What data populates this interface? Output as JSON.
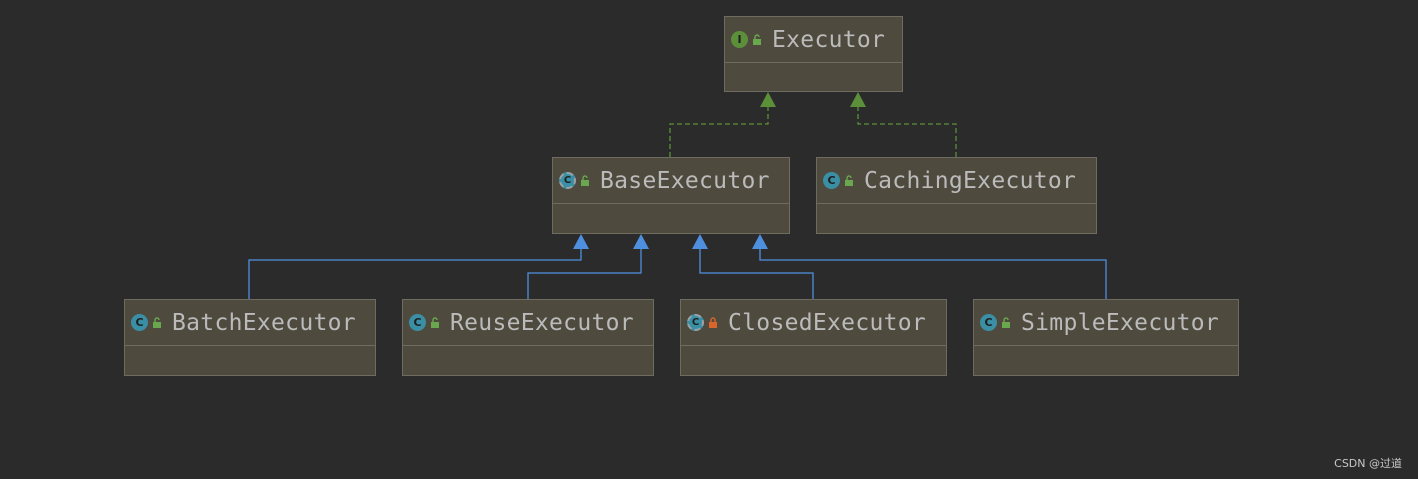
{
  "colors": {
    "background": "#2b2b2b",
    "node_fill": "#4e4a3e",
    "node_border": "#6e6b61",
    "implements_edge": "#5c8f3a",
    "extends_edge": "#4f8fe0",
    "text": "#bbbbbb"
  },
  "nodes": {
    "executor": {
      "label": "Executor",
      "kind": "interface",
      "icon": "interface-icon",
      "access": "public",
      "lock_icon": "unlock-icon"
    },
    "base_executor": {
      "label": "BaseExecutor",
      "kind": "abstract class",
      "icon": "abstract-class-icon",
      "access": "public",
      "lock_icon": "unlock-icon"
    },
    "caching_executor": {
      "label": "CachingExecutor",
      "kind": "class",
      "icon": "class-icon",
      "access": "public",
      "lock_icon": "unlock-icon"
    },
    "batch_executor": {
      "label": "BatchExecutor",
      "kind": "class",
      "icon": "class-icon",
      "access": "public",
      "lock_icon": "unlock-icon"
    },
    "reuse_executor": {
      "label": "ReuseExecutor",
      "kind": "class",
      "icon": "class-icon",
      "access": "public",
      "lock_icon": "unlock-icon"
    },
    "closed_executor": {
      "label": "ClosedExecutor",
      "kind": "class",
      "icon": "class-icon",
      "access": "private",
      "lock_icon": "lock-icon"
    },
    "simple_executor": {
      "label": "SimpleExecutor",
      "kind": "class",
      "icon": "class-icon",
      "access": "public",
      "lock_icon": "unlock-icon"
    }
  },
  "edges": [
    {
      "from": "BaseExecutor",
      "to": "Executor",
      "type": "implements"
    },
    {
      "from": "CachingExecutor",
      "to": "Executor",
      "type": "implements"
    },
    {
      "from": "BatchExecutor",
      "to": "BaseExecutor",
      "type": "extends"
    },
    {
      "from": "ReuseExecutor",
      "to": "BaseExecutor",
      "type": "extends"
    },
    {
      "from": "ClosedExecutor",
      "to": "BaseExecutor",
      "type": "extends"
    },
    {
      "from": "SimpleExecutor",
      "to": "BaseExecutor",
      "type": "extends"
    }
  ],
  "watermark": "CSDN @过道"
}
